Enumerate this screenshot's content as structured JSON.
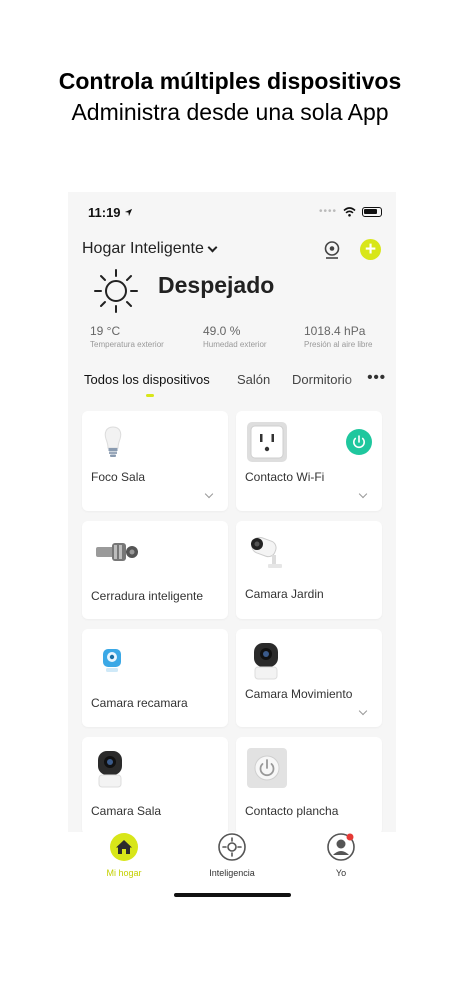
{
  "promo": {
    "title": "Controla múltiples dispositivos",
    "subtitle": "Administra desde una sola App"
  },
  "status_bar": {
    "time": "11:19"
  },
  "header": {
    "home_name": "Hogar Inteligente"
  },
  "weather": {
    "condition": "Despejado",
    "metrics": [
      {
        "value": "19 °C",
        "label": "Temperatura exterior"
      },
      {
        "value": "49.0 %",
        "label": "Humedad exterior"
      },
      {
        "value": "1018.4 hPa",
        "label": "Presión al aire libre"
      }
    ]
  },
  "tabs": [
    {
      "label": "Todos los dispositivos",
      "active": true
    },
    {
      "label": "Salón",
      "active": false
    },
    {
      "label": "Dormitorio",
      "active": false
    }
  ],
  "devices": [
    {
      "name": "Foco Sala",
      "icon": "bulb-icon"
    },
    {
      "name": "Contacto Wi-Fi",
      "icon": "outlet-icon"
    },
    {
      "name": "Cerradura inteligente",
      "icon": "lock-icon"
    },
    {
      "name": "Camara Jardin",
      "icon": "bullet-camera-icon"
    },
    {
      "name": "Camara recamara",
      "icon": "cube-camera-icon"
    },
    {
      "name": "Camara Movimiento",
      "icon": "camera-icon"
    },
    {
      "name": "Camara Sala",
      "icon": "camera-icon"
    },
    {
      "name": "Contacto plancha",
      "icon": "wall-switch-icon"
    }
  ],
  "tabbar": {
    "items": [
      {
        "label": "Mi hogar",
        "icon": "home-icon",
        "active": true
      },
      {
        "label": "Inteligencia",
        "icon": "scene-icon",
        "active": false
      },
      {
        "label": "Yo",
        "icon": "profile-icon",
        "active": false
      }
    ]
  },
  "colors": {
    "accent": "#d8e619",
    "power_on": "#1fc79e",
    "background": "#f6f6f6",
    "card": "#ffffff",
    "notification": "#e53935"
  }
}
